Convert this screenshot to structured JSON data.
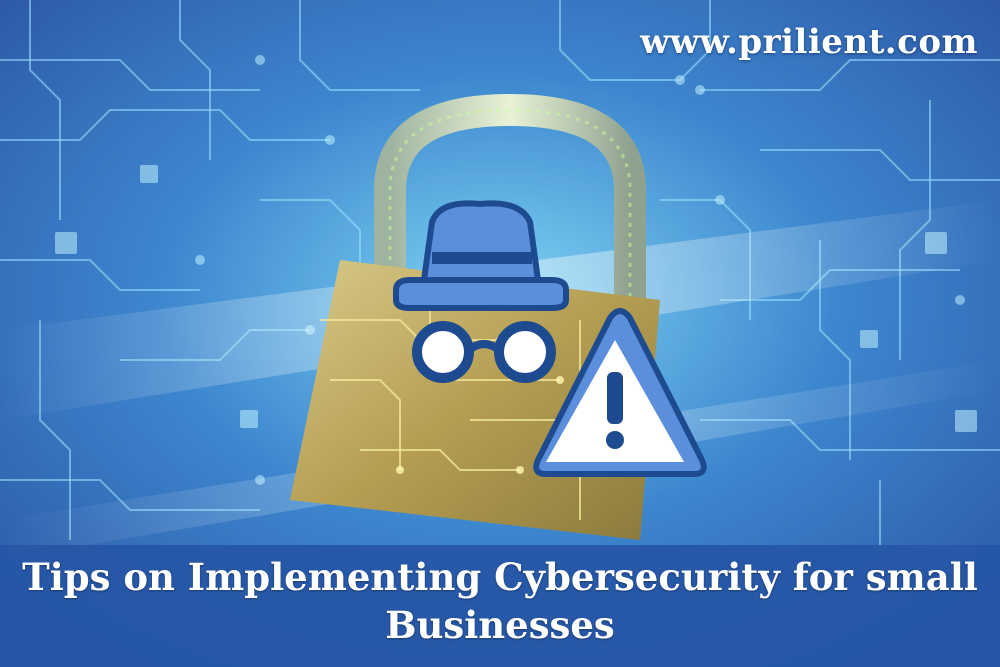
{
  "watermark": {
    "url": "www.prilient.com"
  },
  "banner": {
    "line1": "Tips on Implementing Cybersecurity for small",
    "line2": "Businesses"
  },
  "icons": [
    "padlock-icon",
    "spy-icon",
    "warning-icon"
  ],
  "colors": {
    "background": "#2a5fae",
    "circuit": "#8fe3ff",
    "banner": "#2656a5",
    "padlock": "#b9a35a",
    "icon_fill": "#5b8fdc",
    "icon_stroke": "#1e4a8f",
    "text": "#ffffff"
  }
}
